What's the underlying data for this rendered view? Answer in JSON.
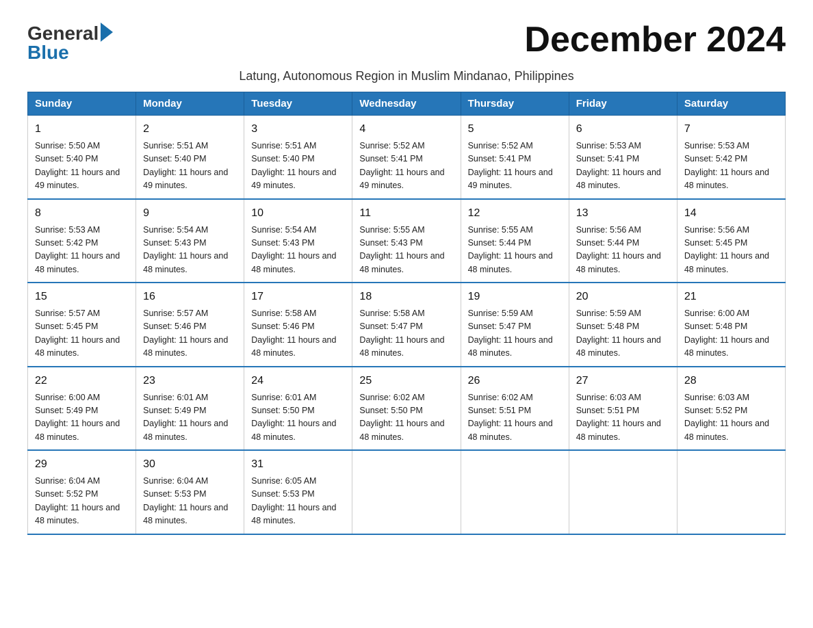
{
  "logo": {
    "general": "General",
    "blue": "Blue"
  },
  "title": "December 2024",
  "subtitle": "Latung, Autonomous Region in Muslim Mindanao, Philippines",
  "headers": [
    "Sunday",
    "Monday",
    "Tuesday",
    "Wednesday",
    "Thursday",
    "Friday",
    "Saturday"
  ],
  "weeks": [
    [
      {
        "day": "1",
        "sunrise": "5:50 AM",
        "sunset": "5:40 PM",
        "daylight": "11 hours and 49 minutes."
      },
      {
        "day": "2",
        "sunrise": "5:51 AM",
        "sunset": "5:40 PM",
        "daylight": "11 hours and 49 minutes."
      },
      {
        "day": "3",
        "sunrise": "5:51 AM",
        "sunset": "5:40 PM",
        "daylight": "11 hours and 49 minutes."
      },
      {
        "day": "4",
        "sunrise": "5:52 AM",
        "sunset": "5:41 PM",
        "daylight": "11 hours and 49 minutes."
      },
      {
        "day": "5",
        "sunrise": "5:52 AM",
        "sunset": "5:41 PM",
        "daylight": "11 hours and 49 minutes."
      },
      {
        "day": "6",
        "sunrise": "5:53 AM",
        "sunset": "5:41 PM",
        "daylight": "11 hours and 48 minutes."
      },
      {
        "day": "7",
        "sunrise": "5:53 AM",
        "sunset": "5:42 PM",
        "daylight": "11 hours and 48 minutes."
      }
    ],
    [
      {
        "day": "8",
        "sunrise": "5:53 AM",
        "sunset": "5:42 PM",
        "daylight": "11 hours and 48 minutes."
      },
      {
        "day": "9",
        "sunrise": "5:54 AM",
        "sunset": "5:43 PM",
        "daylight": "11 hours and 48 minutes."
      },
      {
        "day": "10",
        "sunrise": "5:54 AM",
        "sunset": "5:43 PM",
        "daylight": "11 hours and 48 minutes."
      },
      {
        "day": "11",
        "sunrise": "5:55 AM",
        "sunset": "5:43 PM",
        "daylight": "11 hours and 48 minutes."
      },
      {
        "day": "12",
        "sunrise": "5:55 AM",
        "sunset": "5:44 PM",
        "daylight": "11 hours and 48 minutes."
      },
      {
        "day": "13",
        "sunrise": "5:56 AM",
        "sunset": "5:44 PM",
        "daylight": "11 hours and 48 minutes."
      },
      {
        "day": "14",
        "sunrise": "5:56 AM",
        "sunset": "5:45 PM",
        "daylight": "11 hours and 48 minutes."
      }
    ],
    [
      {
        "day": "15",
        "sunrise": "5:57 AM",
        "sunset": "5:45 PM",
        "daylight": "11 hours and 48 minutes."
      },
      {
        "day": "16",
        "sunrise": "5:57 AM",
        "sunset": "5:46 PM",
        "daylight": "11 hours and 48 minutes."
      },
      {
        "day": "17",
        "sunrise": "5:58 AM",
        "sunset": "5:46 PM",
        "daylight": "11 hours and 48 minutes."
      },
      {
        "day": "18",
        "sunrise": "5:58 AM",
        "sunset": "5:47 PM",
        "daylight": "11 hours and 48 minutes."
      },
      {
        "day": "19",
        "sunrise": "5:59 AM",
        "sunset": "5:47 PM",
        "daylight": "11 hours and 48 minutes."
      },
      {
        "day": "20",
        "sunrise": "5:59 AM",
        "sunset": "5:48 PM",
        "daylight": "11 hours and 48 minutes."
      },
      {
        "day": "21",
        "sunrise": "6:00 AM",
        "sunset": "5:48 PM",
        "daylight": "11 hours and 48 minutes."
      }
    ],
    [
      {
        "day": "22",
        "sunrise": "6:00 AM",
        "sunset": "5:49 PM",
        "daylight": "11 hours and 48 minutes."
      },
      {
        "day": "23",
        "sunrise": "6:01 AM",
        "sunset": "5:49 PM",
        "daylight": "11 hours and 48 minutes."
      },
      {
        "day": "24",
        "sunrise": "6:01 AM",
        "sunset": "5:50 PM",
        "daylight": "11 hours and 48 minutes."
      },
      {
        "day": "25",
        "sunrise": "6:02 AM",
        "sunset": "5:50 PM",
        "daylight": "11 hours and 48 minutes."
      },
      {
        "day": "26",
        "sunrise": "6:02 AM",
        "sunset": "5:51 PM",
        "daylight": "11 hours and 48 minutes."
      },
      {
        "day": "27",
        "sunrise": "6:03 AM",
        "sunset": "5:51 PM",
        "daylight": "11 hours and 48 minutes."
      },
      {
        "day": "28",
        "sunrise": "6:03 AM",
        "sunset": "5:52 PM",
        "daylight": "11 hours and 48 minutes."
      }
    ],
    [
      {
        "day": "29",
        "sunrise": "6:04 AM",
        "sunset": "5:52 PM",
        "daylight": "11 hours and 48 minutes."
      },
      {
        "day": "30",
        "sunrise": "6:04 AM",
        "sunset": "5:53 PM",
        "daylight": "11 hours and 48 minutes."
      },
      {
        "day": "31",
        "sunrise": "6:05 AM",
        "sunset": "5:53 PM",
        "daylight": "11 hours and 48 minutes."
      },
      null,
      null,
      null,
      null
    ]
  ]
}
